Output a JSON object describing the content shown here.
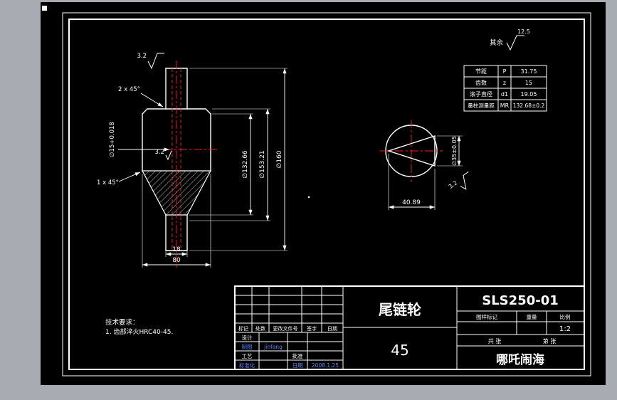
{
  "colors": {
    "app_background": "#a9abb2",
    "canvas_background": "#000000",
    "line": "#ffffff",
    "centerline_red": "#ff1a1a",
    "cad_blue": "#5a82ff"
  },
  "general_note": {
    "label": "其余",
    "value": "12.5"
  },
  "tech_req": {
    "title": "技术要求：",
    "item1": "1. 齿部淬火HRC40-45."
  },
  "param_table": {
    "rows": [
      {
        "name": "节距",
        "symbol": "P",
        "value": "31.75"
      },
      {
        "name": "齿数",
        "symbol": "z",
        "value": "15"
      },
      {
        "name": "滚子直径",
        "symbol": "d1",
        "value": "19.05"
      },
      {
        "name": "量柱测量距",
        "symbol": "MR",
        "value": "132.68±0.2"
      }
    ]
  },
  "front_view": {
    "chamfer_top": "2 x 45°",
    "chamfer_bottom": "1 x 45°",
    "roughness_top": "3.2",
    "roughness_bore": "3.2",
    "bore_dim": "∅15+0.018",
    "dia_root": "∅132.66",
    "dia_pitch": "∅153.21",
    "dia_outer": "∅160",
    "rim_width": "18",
    "hub_length": "80"
  },
  "side_view": {
    "cone_dia": "∅35±0.05",
    "cone_length": "40.89",
    "roughness": "3.2"
  },
  "title_block": {
    "drawing_no": "SLS250-01",
    "part_name": "尾链轮",
    "material": "45",
    "company": "哪吒闹海",
    "stamp_label": "图样标记",
    "weight_label": "重量",
    "scale_label": "比例",
    "scale_value": "1:2",
    "sheet_total": "共  张",
    "sheet_no": "第  张",
    "rev_header": {
      "mark": "标记",
      "count": "处数",
      "doc": "更改文件号",
      "sign": "签字",
      "date": "日期"
    },
    "sig": {
      "design": "设计",
      "draft": "制图",
      "draft_name": "jinfang",
      "process": "工艺",
      "approve": "批准",
      "standardize": "标准化",
      "date_label": "日期",
      "date_value": "2008.1.25"
    }
  }
}
